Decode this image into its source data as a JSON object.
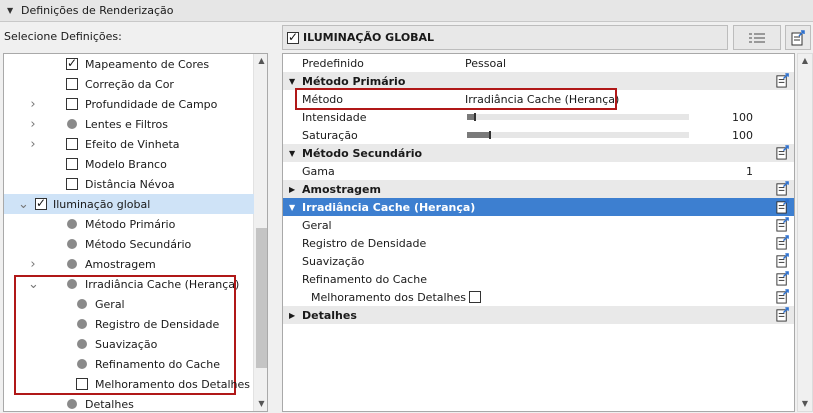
{
  "panel": {
    "title": "Definições de Renderização"
  },
  "left": {
    "label": "Selecione Definições:",
    "tree": [
      {
        "label": "Mapeamento de Cores",
        "control": "checkbox",
        "checked": true,
        "expander": "",
        "level": 1
      },
      {
        "label": "Correção da Cor",
        "control": "checkbox",
        "checked": false,
        "expander": "",
        "level": 1
      },
      {
        "label": "Profundidade de Campo",
        "control": "checkbox",
        "checked": false,
        "expander": "›",
        "level": 1
      },
      {
        "label": "Lentes e Filtros",
        "control": "dot",
        "expander": "›",
        "level": 1
      },
      {
        "label": "Efeito de Vinheta",
        "control": "checkbox",
        "checked": false,
        "expander": "›",
        "level": 1
      },
      {
        "label": "Modelo Branco",
        "control": "checkbox",
        "checked": false,
        "expander": "",
        "level": 1
      },
      {
        "label": "Distância Névoa",
        "control": "checkbox",
        "checked": false,
        "expander": "",
        "level": 1
      },
      {
        "label": "Iluminação global",
        "control": "checkbox",
        "checked": true,
        "expander": "⌄",
        "level": 0,
        "selected": true
      },
      {
        "label": "Método Primário",
        "control": "dot",
        "expander": "",
        "level": 1
      },
      {
        "label": "Método Secundário",
        "control": "dot",
        "expander": "",
        "level": 1
      },
      {
        "label": "Amostragem",
        "control": "dot",
        "expander": "›",
        "level": 1
      },
      {
        "label": "Irradiância Cache (Herança)",
        "control": "dot",
        "expander": "⌄",
        "level": 1
      },
      {
        "label": "Geral",
        "control": "dot",
        "expander": "",
        "level": 2
      },
      {
        "label": "Registro de Densidade",
        "control": "dot",
        "expander": "",
        "level": 2
      },
      {
        "label": "Suavização",
        "control": "dot",
        "expander": "",
        "level": 2
      },
      {
        "label": "Refinamento do Cache",
        "control": "dot",
        "expander": "",
        "level": 2
      },
      {
        "label": "Melhoramento dos Detalhes",
        "control": "checkbox",
        "checked": false,
        "expander": "",
        "level": 2
      },
      {
        "label": "Detalhes",
        "control": "dot",
        "expander": "",
        "level": 1
      }
    ]
  },
  "right": {
    "header": {
      "title": "ILUMINAÇÃO GLOBAL",
      "checked": true
    },
    "rows": [
      {
        "type": "prop",
        "label": "Predefinido",
        "value": "Pessoal"
      },
      {
        "type": "section",
        "label": "Método Primário",
        "expanded": true
      },
      {
        "type": "prop",
        "label": "Método",
        "value": "Irradiância Cache (Herança)"
      },
      {
        "type": "slider",
        "label": "Intensidade",
        "number": "100",
        "level": 0.03
      },
      {
        "type": "slider",
        "label": "Saturação",
        "number": "100",
        "level": 0.1
      },
      {
        "type": "section",
        "label": "Método Secundário",
        "expanded": true
      },
      {
        "type": "prop",
        "label": "Gama",
        "value": "",
        "number": "1"
      },
      {
        "type": "section",
        "label": "Amostragem",
        "expanded": false
      },
      {
        "type": "section",
        "label": "Irradiância Cache (Herança)",
        "expanded": true,
        "active": true
      },
      {
        "type": "sub",
        "label": "Geral"
      },
      {
        "type": "sub",
        "label": "Registro de Densidade"
      },
      {
        "type": "sub",
        "label": "Suavização"
      },
      {
        "type": "sub",
        "label": "Refinamento do Cache"
      },
      {
        "type": "subcheck",
        "label": "Melhoramento dos Detalhes",
        "checked": false
      },
      {
        "type": "section",
        "label": "Detalhes",
        "expanded": false
      }
    ]
  },
  "colors": {
    "accent": "#3d7fd0",
    "highlight": "#b01818",
    "selection": "#cfe3f7"
  }
}
